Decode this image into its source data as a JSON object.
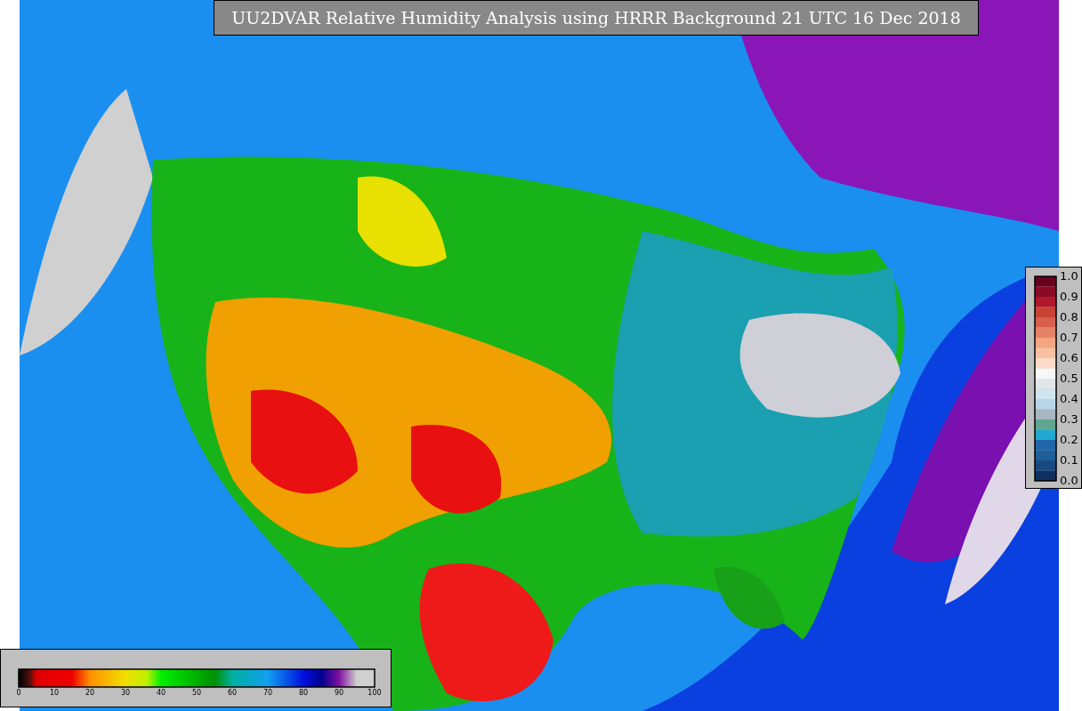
{
  "title": "UU2DVAR Relative Humidity Analysis using HRRR Background 21 UTC 16 Dec 2018",
  "humidity_colorbar": {
    "ticks": [
      "0",
      "10",
      "20",
      "30",
      "40",
      "50",
      "60",
      "70",
      "80",
      "90",
      "100"
    ]
  },
  "station_colorbar": {
    "ticks": [
      "1.0",
      "0.9",
      "0.8",
      "0.7",
      "0.6",
      "0.5",
      "0.4",
      "0.3",
      "0.2",
      "0.1",
      "0.0"
    ]
  }
}
